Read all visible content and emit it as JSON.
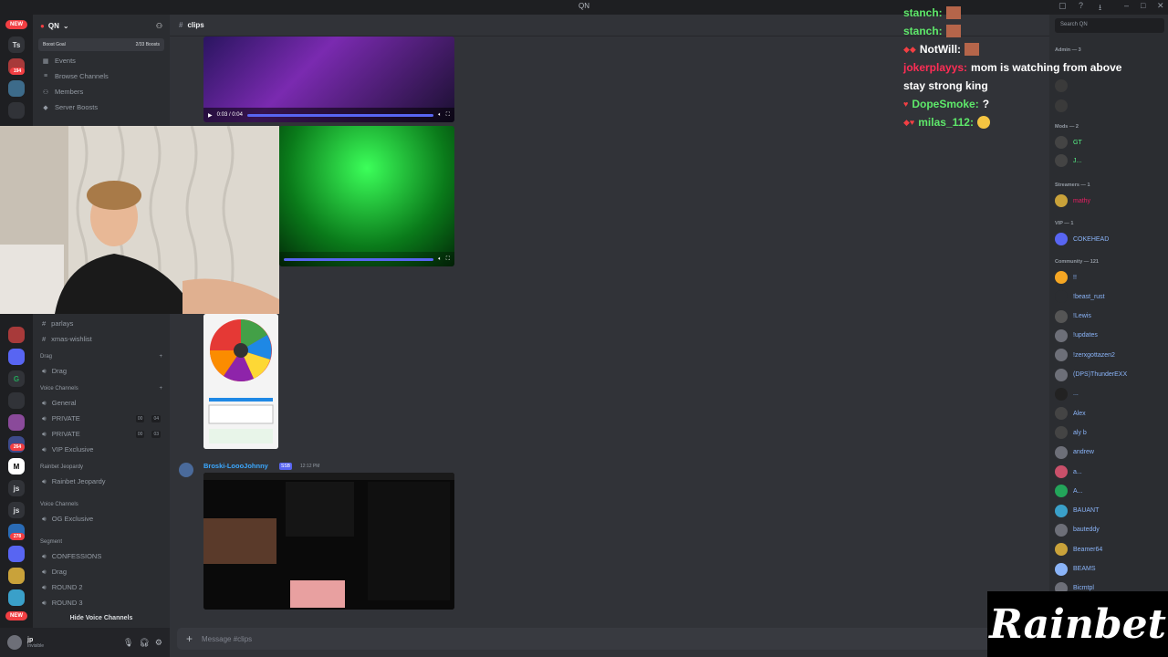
{
  "window": {
    "title": "QN"
  },
  "servers": {
    "new_label": "NEW",
    "ts_label": "Ts",
    "badges": [
      "194",
      "264",
      "278"
    ],
    "js_label": "js"
  },
  "guild": {
    "name": "QN",
    "boost_goal": "Boost Goal",
    "boost_count": "2/33 Boosts",
    "nav": [
      {
        "label": "Events",
        "icon": "calendar-icon"
      },
      {
        "label": "Browse Channels",
        "icon": "list-icon"
      },
      {
        "label": "Members",
        "icon": "members-icon"
      },
      {
        "label": "Server Boosts",
        "icon": "boost-icon"
      }
    ],
    "channels_top": [
      "parlays",
      "xmas-wishlist"
    ],
    "categories": [
      {
        "name": "Drag",
        "channels": [
          {
            "name": "Drag",
            "type": "voice"
          }
        ]
      },
      {
        "name": "Voice Channels",
        "channels": [
          {
            "name": "General",
            "type": "voice"
          },
          {
            "name": "PRIVATE",
            "type": "voice",
            "c1": "00",
            "c2": "04"
          },
          {
            "name": "PRIVATE",
            "type": "voice",
            "c1": "00",
            "c2": "03"
          },
          {
            "name": "VIP Exclusive",
            "type": "voice"
          }
        ]
      },
      {
        "name": "Rainbet Jeopardy",
        "channels": [
          {
            "name": "Rainbet Jeopardy",
            "type": "voice"
          }
        ]
      },
      {
        "name": "Voice Channels",
        "channels": [
          {
            "name": "OG Exclusive",
            "type": "voice"
          }
        ]
      },
      {
        "name": "Segment",
        "channels": [
          {
            "name": "CONFESSIONS",
            "type": "voice"
          },
          {
            "name": "Drag",
            "type": "voice"
          },
          {
            "name": "ROUND 2",
            "type": "voice"
          },
          {
            "name": "ROUND 3",
            "type": "voice"
          }
        ]
      }
    ],
    "hide_voice": "Hide Voice Channels"
  },
  "user": {
    "name": "jp",
    "status": "Invisible"
  },
  "channel": {
    "name": "clips",
    "video1_time": "0:03 / 0:04",
    "author": "Broski-LoooJohnny",
    "author_tag": "SSB",
    "author_time": "12:12 PM",
    "composer_placeholder": "Message #clips"
  },
  "members": {
    "search_placeholder": "Search QN",
    "groups": [
      {
        "title": "Admin — 3",
        "items": [
          "",
          ""
        ]
      },
      {
        "title": "Mods — 2",
        "items": [
          "GT",
          "J..."
        ]
      },
      {
        "title": "Streamers — 1",
        "items": [
          "mathy"
        ]
      },
      {
        "title": "VIP — 1",
        "items": [
          "COKEHEAD"
        ]
      },
      {
        "title": "Community — 121",
        "items": [
          "!!",
          "!beast_rust",
          "!Lewis",
          "!updates",
          "!zerxgottazen2",
          "(DPS)ThunderEXX",
          "...",
          "Alex",
          "aly b",
          "andrew",
          "a...",
          "A...",
          "BAUANT",
          "bauteddy",
          "Beamer64",
          "BEAMS",
          "Bicmtpl"
        ]
      }
    ]
  },
  "chat": [
    {
      "user": "stanch:",
      "color": "#5ee86a",
      "text": ""
    },
    {
      "user": "stanch:",
      "color": "#5ee86a",
      "text": ""
    },
    {
      "user": "NotWill:",
      "color": "#ffffff",
      "text": ""
    },
    {
      "user": "jokerplayys:",
      "color": "#ff2d55",
      "text": "mom is watching from above"
    },
    {
      "user": "",
      "color": "#ffffff",
      "text": "stay strong king"
    },
    {
      "user": "DopeSmoke:",
      "color": "#5ee86a",
      "text": "?"
    },
    {
      "user": "milas_112:",
      "color": "#5ee86a",
      "text": ""
    }
  ],
  "brand": {
    "name": "Rainbet"
  },
  "colors": {
    "accent": "#5865f2",
    "bg": "#313338",
    "sidebar": "#2b2d31",
    "dark": "#1e1f22"
  }
}
